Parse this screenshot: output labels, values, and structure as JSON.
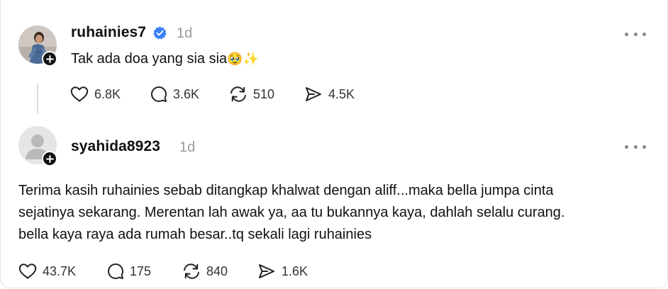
{
  "post": {
    "username": "ruhainies7",
    "time": "1d",
    "verified": true,
    "text": "Tak ada doa yang sia sia",
    "emoji": "🥹✨",
    "actions": {
      "likes": "6.8K",
      "replies": "3.6K",
      "reposts": "510",
      "shares": "4.5K"
    }
  },
  "reply": {
    "username": "syahida8923",
    "time": "1d",
    "text_lines": [
      "Terima kasih ruhainies sebab ditangkap khalwat dengan aliff...maka bella jumpa cinta",
      "sejatinya sekarang. Merentan lah awak ya, aa tu bukannya kaya, dahlah selalu curang.",
      "bella kaya raya ada rumah besar..tq sekali lagi ruhainies"
    ],
    "actions": {
      "likes": "43.7K",
      "replies": "175",
      "reposts": "840",
      "shares": "1.6K"
    }
  },
  "colors": {
    "text": "#111111",
    "muted": "#9a9a9a",
    "verified": "#3b82f6",
    "badge": "#111111"
  },
  "icons": [
    "heart-icon",
    "comment-icon",
    "repost-icon",
    "share-icon",
    "more-icon",
    "verified-icon",
    "follow-plus-icon",
    "default-avatar-icon"
  ]
}
